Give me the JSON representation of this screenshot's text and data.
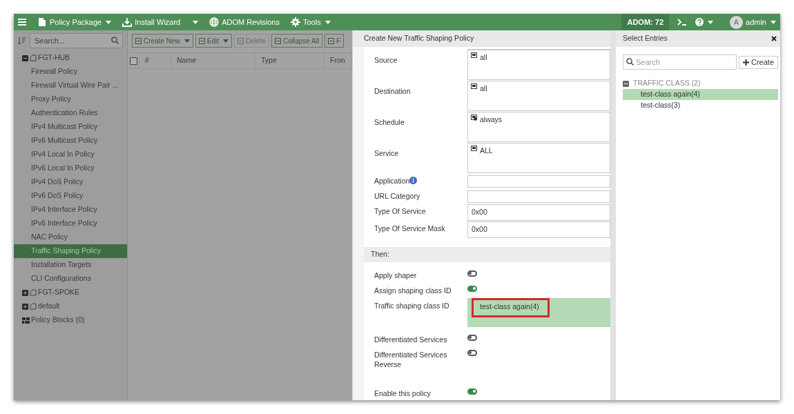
{
  "topbar": {
    "menus": [
      {
        "label": "Policy Package",
        "caret": true
      },
      {
        "label": "Install Wizard",
        "caret": true
      },
      {
        "label": "ADOM Revisions",
        "caret": false
      },
      {
        "label": "Tools",
        "caret": true
      }
    ],
    "adom": "ADOM: 72",
    "user": {
      "initial": "A",
      "name": "admin"
    }
  },
  "sidebar": {
    "search_placeholder": "Search...",
    "tree": [
      {
        "label": "FGT-HUB",
        "kind": "device",
        "expanded": true,
        "children": [
          {
            "label": "Firewall Policy",
            "selected": false
          },
          {
            "label": "Firewall Virtual Wire Pair ...",
            "selected": false
          },
          {
            "label": "Proxy Policy",
            "selected": false
          },
          {
            "label": "Authentication Rules",
            "selected": false
          },
          {
            "label": "IPv4 Multicast Policy",
            "selected": false
          },
          {
            "label": "IPv6 Multicast Policy",
            "selected": false
          },
          {
            "label": "IPv4 Local In Policy",
            "selected": false
          },
          {
            "label": "IPv6 Local In Policy",
            "selected": false
          },
          {
            "label": "IPv4 DoS Policy",
            "selected": false
          },
          {
            "label": "IPv6 DoS Policy",
            "selected": false
          },
          {
            "label": "IPv4 Interface Policy",
            "selected": false
          },
          {
            "label": "IPv6 Interface Policy",
            "selected": false
          },
          {
            "label": "NAC Policy",
            "selected": false
          },
          {
            "label": "Traffic Shaping Policy",
            "selected": true
          },
          {
            "label": "Installation Targets",
            "selected": false
          },
          {
            "label": "CLI Configurations",
            "selected": false
          }
        ]
      },
      {
        "label": "FGT-SPOKE",
        "kind": "device",
        "expanded": false
      },
      {
        "label": "default",
        "kind": "device",
        "expanded": false
      },
      {
        "label": "Policy Blocks (0)",
        "kind": "blocks"
      }
    ]
  },
  "toolbar": [
    {
      "label": "Create New",
      "caret": true,
      "disabled": false
    },
    {
      "label": "Edit",
      "caret": true,
      "disabled": false
    },
    {
      "label": "Delete",
      "caret": false,
      "disabled": true
    },
    {
      "label": "Collapse All",
      "caret": false,
      "disabled": false
    },
    {
      "label": "F",
      "caret": false,
      "disabled": false
    }
  ],
  "table": {
    "select_all_checked": false,
    "columns": [
      "#",
      "Name",
      "Type",
      "Fron"
    ]
  },
  "panel": {
    "title": "Create New Traffic Shaping Policy",
    "rows": [
      {
        "kind": "list",
        "label": "Source",
        "value": "all"
      },
      {
        "kind": "list",
        "label": "Destination",
        "value": "all"
      },
      {
        "kind": "list",
        "label": "Schedule",
        "value": "always"
      },
      {
        "kind": "list",
        "label": "Service",
        "value": "ALL"
      },
      {
        "kind": "text",
        "label": "Application",
        "info": true
      },
      {
        "kind": "text",
        "label": "URL Category",
        "info": false
      },
      {
        "kind": "input",
        "label": "Type Of Service",
        "value": "0x00"
      },
      {
        "kind": "input",
        "label": "Type Of Service Mask",
        "value": "0x00"
      }
    ],
    "section": "Then:",
    "then_rows": [
      {
        "kind": "toggle",
        "label": "Apply shaper",
        "on": false
      },
      {
        "kind": "toggle",
        "label": "Assign shaping class ID",
        "on": true
      },
      {
        "kind": "select",
        "label": "Traffic shaping class ID",
        "value": "test-class again(4)"
      },
      {
        "kind": "toggle",
        "label": "Differentiated Services",
        "on": false
      },
      {
        "kind": "toggle",
        "label": "Differentiated Services Reverse",
        "on": false
      },
      {
        "kind": "toggle",
        "label": "Enable this policy",
        "on": true
      }
    ]
  },
  "select_entries": {
    "title": "Select Entries",
    "search_placeholder": "Search",
    "create": "Create",
    "group": {
      "label": "TRAFFIC CLASS (2)",
      "expanded": true,
      "items": [
        {
          "label": "test-class again(4)",
          "selected": true
        },
        {
          "label": "test-class(3)",
          "selected": false
        }
      ]
    }
  }
}
